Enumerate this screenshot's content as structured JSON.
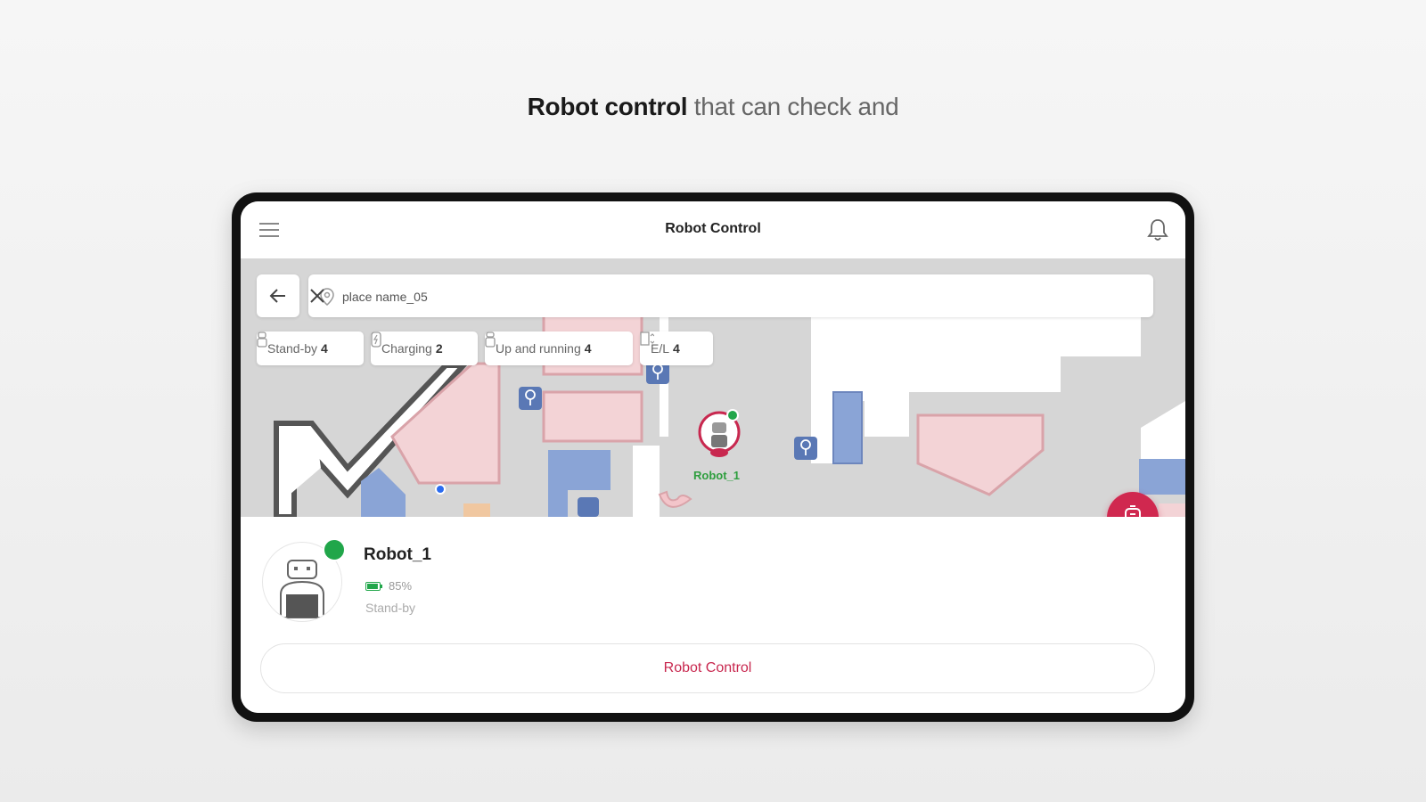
{
  "headline": {
    "bold": "Robot control",
    "light": "that can check and"
  },
  "app": {
    "title": "Robot Control",
    "icons": {
      "menu": "hamburger-menu-icon",
      "notifications": "bell-icon"
    }
  },
  "search": {
    "value": "place name_05",
    "placeholder": "place name_05",
    "icons": {
      "back": "arrow-left-icon",
      "location": "location-pin-icon",
      "clear": "close-icon"
    }
  },
  "filters": [
    {
      "label": "Stand-by",
      "count": "4",
      "icon": "standby-robot-icon"
    },
    {
      "label": "Charging",
      "count": "2",
      "icon": "charging-robot-icon"
    },
    {
      "label": "Up and running",
      "count": "4",
      "icon": "running-robot-icon"
    },
    {
      "label": "E/L",
      "count": "4",
      "icon": "elevator-icon"
    }
  ],
  "map": {
    "robot_marker_label": "Robot_1",
    "colors": {
      "floor": "#d6d6d6",
      "room": "#f3d3d6",
      "room_stroke": "#d9a3a9",
      "poi": "#5a78b5",
      "wall": "#ffffff"
    }
  },
  "robot": {
    "name": "Robot_1",
    "battery": "85%",
    "battery_level": 0.85,
    "status": "Stand-by",
    "online_color": "#21a64a"
  },
  "actions": {
    "control_button": "Robot Control",
    "accent": "#c8284f"
  }
}
